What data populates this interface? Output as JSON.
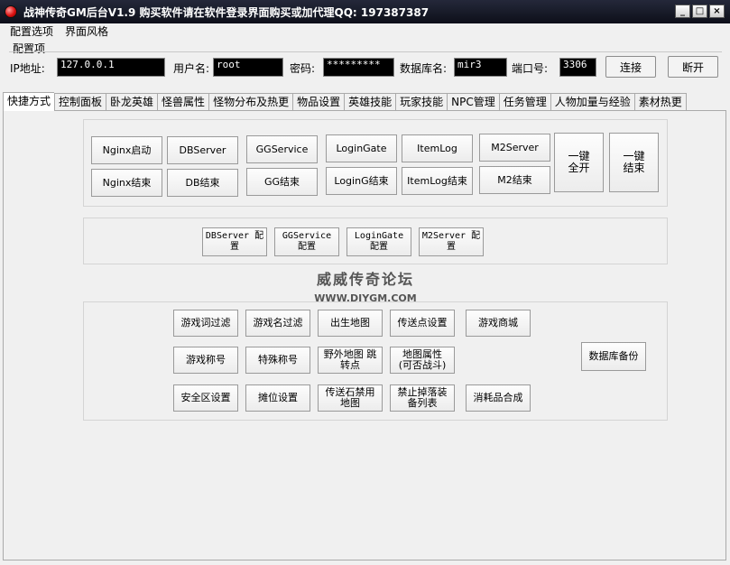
{
  "window": {
    "title": "战神传奇GM后台V1.9   购买软件请在软件登录界面购买或加代理QQ:  197387387",
    "controls": {
      "minimize": "_",
      "maximize": "□",
      "close": "×"
    }
  },
  "menu": [
    "配置选项",
    "界面风格"
  ],
  "config": {
    "group_label": "配置项",
    "ip_label": "IP地址:",
    "ip_value": "127.0.0.1",
    "user_label": "用户名:",
    "user_value": "root",
    "password_label": "密码:",
    "password_value": "*********",
    "db_label": "数据库名:",
    "db_value": "mir3",
    "port_label": "端口号:",
    "port_value": "3306",
    "connect": "连接",
    "disconnect": "断开"
  },
  "tabs": [
    "快捷方式",
    "控制面板",
    "卧龙英雄",
    "怪兽属性",
    "怪物分布及热更",
    "物品设置",
    "英雄技能",
    "玩家技能",
    "NPC管理",
    "任务管理",
    "人物加量与经验",
    "素材热更"
  ],
  "active_tab": "快捷方式",
  "server_buttons": {
    "nginx_start": "Nginx启动",
    "nginx_end": "Nginx结束",
    "db_server": "DBServer",
    "db_end": "DB结束",
    "gg_service": "GGService",
    "gg_end": "GG结束",
    "login_gate": "LoginGate",
    "login_end": "LoginG结束",
    "item_log": "ItemLog",
    "item_log_end": "ItemLog结束",
    "m2_server": "M2Server",
    "m2_end": "M2结束",
    "one_key_start": "一键\n全开",
    "one_key_end": "一键\n结束"
  },
  "config_buttons": {
    "db_cfg": "DBServer 配\n置",
    "gg_cfg": "GGService\n配置",
    "login_cfg": "LoginGate\n配置",
    "m2_cfg": "M2Server 配\n置"
  },
  "watermark": {
    "cn": "威威传奇论坛",
    "en": "WWW.DIYGM.COM"
  },
  "tool_buttons": {
    "word_filter": "游戏词过滤",
    "name_filter": "游戏名过滤",
    "birth_map": "出生地图",
    "teleport": "传送点设置",
    "shop": "游戏商城",
    "titles": "游戏称号",
    "special_titles": "特殊称号",
    "wild_map": "野外地图 跳\n转点",
    "map_attr": "地图属性\n(可否战斗)",
    "safe_zone": "安全区设置",
    "stall": "摊位设置",
    "stone_ban": "传送石禁用\n地图",
    "drop_ban": "禁止掉落装\n备列表",
    "consumable": "消耗品合成",
    "db_backup": "数据库备份"
  }
}
